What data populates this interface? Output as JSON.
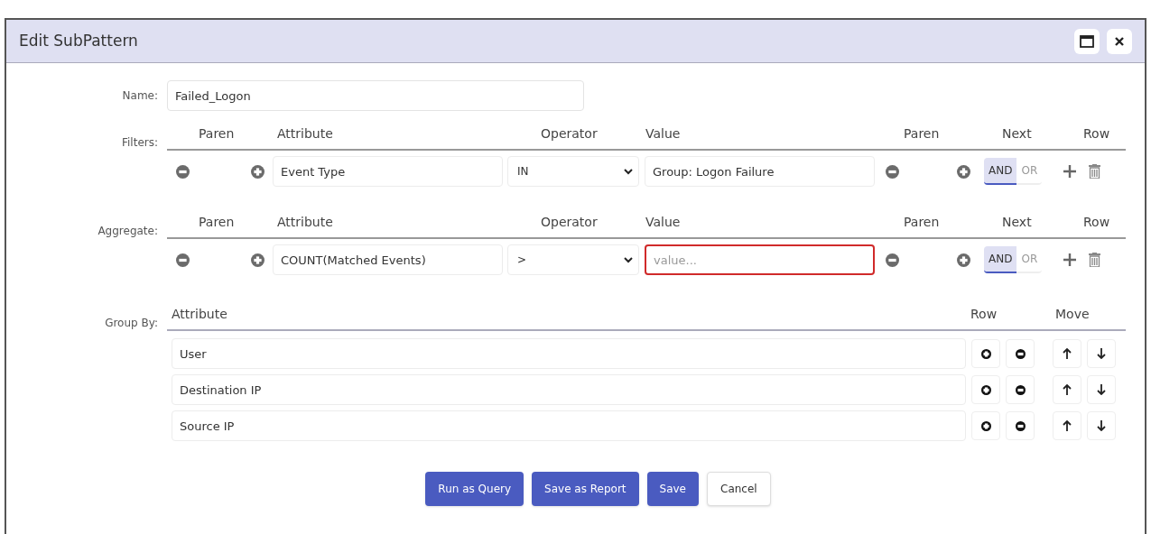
{
  "window": {
    "title": "Edit SubPattern"
  },
  "name_field": {
    "label": "Name:",
    "value": "Failed_Logon"
  },
  "filters": {
    "label": "Filters:",
    "columns": [
      "Paren",
      "Attribute",
      "Operator",
      "Value",
      "Paren",
      "Next",
      "Row"
    ],
    "rows": [
      {
        "attribute": "Event Type",
        "operator": "IN",
        "value": "Group: Logon Failure",
        "invalid": false,
        "next": [
          {
            "label": "AND",
            "selected": true
          },
          {
            "label": "OR",
            "selected": false
          }
        ]
      }
    ]
  },
  "aggregate": {
    "label": "Aggregate:",
    "columns": [
      "Paren",
      "Attribute",
      "Operator",
      "Value",
      "Paren",
      "Next",
      "Row"
    ],
    "rows": [
      {
        "attribute": "COUNT(Matched Events)",
        "operator": ">",
        "placeholder": "value...",
        "invalid": true,
        "next": [
          {
            "label": "AND",
            "selected": true
          },
          {
            "label": "OR",
            "selected": false
          }
        ]
      }
    ]
  },
  "group_by": {
    "label": "Group By:",
    "columns": [
      "Attribute",
      "Row",
      "Move"
    ],
    "rows": [
      {
        "attribute": "User"
      },
      {
        "attribute": "Destination IP"
      },
      {
        "attribute": "Source IP"
      }
    ]
  },
  "buttons": [
    {
      "label": "Run as Query",
      "kind": "primary"
    },
    {
      "label": "Save as Report",
      "kind": "primary"
    },
    {
      "label": "Save",
      "kind": "primary"
    },
    {
      "label": "Cancel",
      "kind": "secondary"
    }
  ]
}
